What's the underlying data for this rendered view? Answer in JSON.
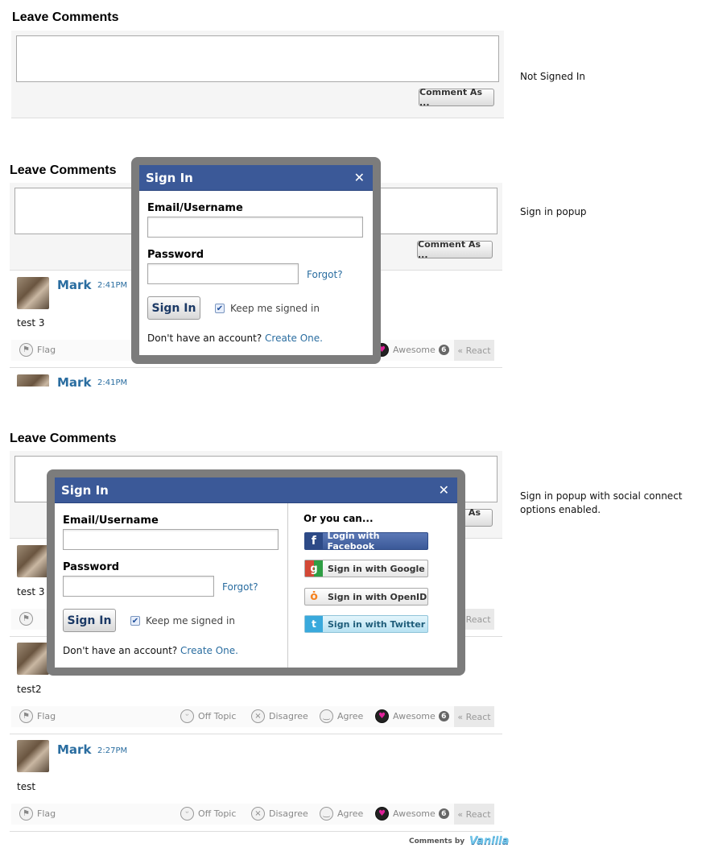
{
  "sections": {
    "title": "Leave Comments",
    "comment_as": "Comment As ..."
  },
  "notes": {
    "not_signed_in": "Not Signed In",
    "popup": "Sign in popup",
    "social": "Sign in popup with social connect options enabled."
  },
  "popup": {
    "title": "Sign In",
    "close": "✕",
    "email_label": "Email/Username",
    "password_label": "Password",
    "forgot": "Forgot?",
    "signin_button": "Sign In",
    "keep_signed_in": "Keep me signed in",
    "no_account": "Don't have an account?",
    "create": "Create One.",
    "or_you_can": "Or you can...",
    "social": {
      "facebook": "Login with Facebook",
      "google": "Sign in with Google",
      "openid": "Sign in with OpenID",
      "twitter": "Sign in with Twitter"
    }
  },
  "comments": [
    {
      "author": "Mark",
      "time": "2:41PM",
      "text": "test 3"
    },
    {
      "author": "Mark",
      "time": "2:41PM",
      "text": "test2"
    },
    {
      "author": "Mark",
      "time": "2:27PM",
      "text": "test"
    }
  ],
  "reactions": {
    "flag": "Flag",
    "off_topic": "Off Topic",
    "disagree": "Disagree",
    "agree": "Agree",
    "awesome": "Awesome",
    "awesome_count": "6",
    "react": "« React"
  },
  "footer": {
    "comments_by": "Comments by",
    "brand": "Vanilla"
  },
  "colors": {
    "accent": "#2a6da0",
    "popup_header": "#3b5998",
    "facebook": "#3b5998",
    "twitter": "#c6e9f5"
  }
}
